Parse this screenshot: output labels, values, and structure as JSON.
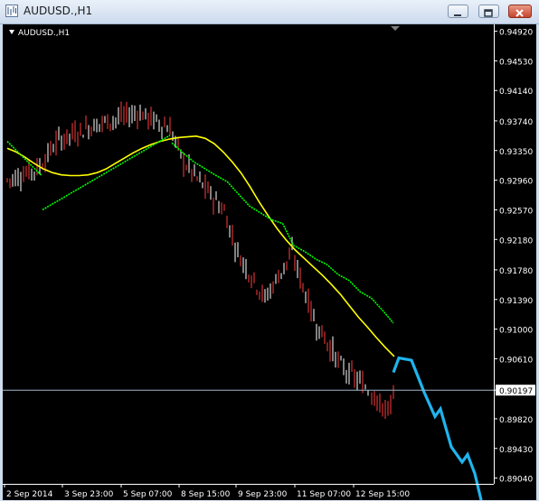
{
  "window": {
    "title": "AUDUSD.,H1",
    "minimize_icon": "minimize-icon",
    "maximize_icon": "restore-icon",
    "close_icon": "close-icon"
  },
  "chart": {
    "symbol_label": "AUDUSD.,H1",
    "current_price": "0.90197",
    "price_ticks": [
      "0.94920",
      "0.94530",
      "0.94140",
      "0.93740",
      "0.93350",
      "0.92960",
      "0.92570",
      "0.92180",
      "0.91780",
      "0.91390",
      "0.91000",
      "0.90610",
      "0.90197",
      "0.89820",
      "0.89430",
      "0.89040"
    ],
    "time_ticks": [
      "2 Sep 2014",
      "3 Sep 23:00",
      "5 Sep 07:00",
      "8 Sep 15:00",
      "9 Sep 23:00",
      "11 Sep 07:00",
      "12 Sep 15:00"
    ],
    "colors": {
      "background": "#000000",
      "bull_bar": "#ff3b3b",
      "bear_bar": "#ffffff",
      "ma_yellow": "#ffff00",
      "ma_green": "#00ff00",
      "forecast": "#1fb4ee",
      "axis": "#ffffff",
      "price_line": "#9fb6cc"
    }
  },
  "chart_data": {
    "type": "line",
    "ylim": [
      0.88964,
      0.9501
    ],
    "series": [
      {
        "values": [
          0.9338,
          0.9333,
          0.9326,
          0.9318,
          0.9311,
          0.9306,
          0.9303,
          0.9302,
          0.9302,
          0.9303,
          0.9306,
          0.9311,
          0.9318,
          0.9325,
          0.9332,
          0.9338,
          0.9343,
          0.9347,
          0.935,
          0.9352,
          0.9353,
          0.9354,
          0.9351,
          0.9344,
          0.9333,
          0.932,
          0.9305,
          0.9287,
          0.9267,
          0.9249,
          0.9232,
          0.9217,
          0.9204,
          0.9193,
          0.9182,
          0.9171,
          0.9159,
          0.9146,
          0.9131,
          0.9116,
          0.9103,
          0.9089,
          0.9076,
          0.9064
        ]
      },
      {
        "values": [
          0.9345,
          0.9332,
          0.932,
          0.9311,
          0.9302,
          0.9294,
          0.9278,
          0.9262,
          0.9253,
          0.9244,
          0.9239,
          0.921,
          0.9202,
          0.9192,
          0.9185,
          0.9172,
          0.9164,
          0.9149,
          0.9141,
          0.9125,
          0.9108
        ]
      },
      {
        "values": [
          0.9043,
          0.9062,
          0.9059,
          0.9017,
          0.8985,
          0.8995,
          0.8945,
          0.8925,
          0.8935,
          0.891,
          0.887
        ]
      }
    ]
  }
}
